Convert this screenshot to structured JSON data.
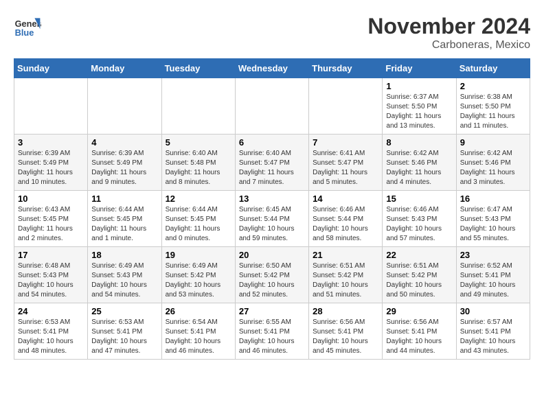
{
  "header": {
    "logo_general": "General",
    "logo_blue": "Blue",
    "title": "November 2024",
    "subtitle": "Carboneras, Mexico"
  },
  "days_of_week": [
    "Sunday",
    "Monday",
    "Tuesday",
    "Wednesday",
    "Thursday",
    "Friday",
    "Saturday"
  ],
  "weeks": [
    [
      {
        "day": "",
        "info": ""
      },
      {
        "day": "",
        "info": ""
      },
      {
        "day": "",
        "info": ""
      },
      {
        "day": "",
        "info": ""
      },
      {
        "day": "",
        "info": ""
      },
      {
        "day": "1",
        "info": "Sunrise: 6:37 AM\nSunset: 5:50 PM\nDaylight: 11 hours and 13 minutes."
      },
      {
        "day": "2",
        "info": "Sunrise: 6:38 AM\nSunset: 5:50 PM\nDaylight: 11 hours and 11 minutes."
      }
    ],
    [
      {
        "day": "3",
        "info": "Sunrise: 6:39 AM\nSunset: 5:49 PM\nDaylight: 11 hours and 10 minutes."
      },
      {
        "day": "4",
        "info": "Sunrise: 6:39 AM\nSunset: 5:49 PM\nDaylight: 11 hours and 9 minutes."
      },
      {
        "day": "5",
        "info": "Sunrise: 6:40 AM\nSunset: 5:48 PM\nDaylight: 11 hours and 8 minutes."
      },
      {
        "day": "6",
        "info": "Sunrise: 6:40 AM\nSunset: 5:47 PM\nDaylight: 11 hours and 7 minutes."
      },
      {
        "day": "7",
        "info": "Sunrise: 6:41 AM\nSunset: 5:47 PM\nDaylight: 11 hours and 5 minutes."
      },
      {
        "day": "8",
        "info": "Sunrise: 6:42 AM\nSunset: 5:46 PM\nDaylight: 11 hours and 4 minutes."
      },
      {
        "day": "9",
        "info": "Sunrise: 6:42 AM\nSunset: 5:46 PM\nDaylight: 11 hours and 3 minutes."
      }
    ],
    [
      {
        "day": "10",
        "info": "Sunrise: 6:43 AM\nSunset: 5:45 PM\nDaylight: 11 hours and 2 minutes."
      },
      {
        "day": "11",
        "info": "Sunrise: 6:44 AM\nSunset: 5:45 PM\nDaylight: 11 hours and 1 minute."
      },
      {
        "day": "12",
        "info": "Sunrise: 6:44 AM\nSunset: 5:45 PM\nDaylight: 11 hours and 0 minutes."
      },
      {
        "day": "13",
        "info": "Sunrise: 6:45 AM\nSunset: 5:44 PM\nDaylight: 10 hours and 59 minutes."
      },
      {
        "day": "14",
        "info": "Sunrise: 6:46 AM\nSunset: 5:44 PM\nDaylight: 10 hours and 58 minutes."
      },
      {
        "day": "15",
        "info": "Sunrise: 6:46 AM\nSunset: 5:43 PM\nDaylight: 10 hours and 57 minutes."
      },
      {
        "day": "16",
        "info": "Sunrise: 6:47 AM\nSunset: 5:43 PM\nDaylight: 10 hours and 55 minutes."
      }
    ],
    [
      {
        "day": "17",
        "info": "Sunrise: 6:48 AM\nSunset: 5:43 PM\nDaylight: 10 hours and 54 minutes."
      },
      {
        "day": "18",
        "info": "Sunrise: 6:49 AM\nSunset: 5:43 PM\nDaylight: 10 hours and 54 minutes."
      },
      {
        "day": "19",
        "info": "Sunrise: 6:49 AM\nSunset: 5:42 PM\nDaylight: 10 hours and 53 minutes."
      },
      {
        "day": "20",
        "info": "Sunrise: 6:50 AM\nSunset: 5:42 PM\nDaylight: 10 hours and 52 minutes."
      },
      {
        "day": "21",
        "info": "Sunrise: 6:51 AM\nSunset: 5:42 PM\nDaylight: 10 hours and 51 minutes."
      },
      {
        "day": "22",
        "info": "Sunrise: 6:51 AM\nSunset: 5:42 PM\nDaylight: 10 hours and 50 minutes."
      },
      {
        "day": "23",
        "info": "Sunrise: 6:52 AM\nSunset: 5:41 PM\nDaylight: 10 hours and 49 minutes."
      }
    ],
    [
      {
        "day": "24",
        "info": "Sunrise: 6:53 AM\nSunset: 5:41 PM\nDaylight: 10 hours and 48 minutes."
      },
      {
        "day": "25",
        "info": "Sunrise: 6:53 AM\nSunset: 5:41 PM\nDaylight: 10 hours and 47 minutes."
      },
      {
        "day": "26",
        "info": "Sunrise: 6:54 AM\nSunset: 5:41 PM\nDaylight: 10 hours and 46 minutes."
      },
      {
        "day": "27",
        "info": "Sunrise: 6:55 AM\nSunset: 5:41 PM\nDaylight: 10 hours and 46 minutes."
      },
      {
        "day": "28",
        "info": "Sunrise: 6:56 AM\nSunset: 5:41 PM\nDaylight: 10 hours and 45 minutes."
      },
      {
        "day": "29",
        "info": "Sunrise: 6:56 AM\nSunset: 5:41 PM\nDaylight: 10 hours and 44 minutes."
      },
      {
        "day": "30",
        "info": "Sunrise: 6:57 AM\nSunset: 5:41 PM\nDaylight: 10 hours and 43 minutes."
      }
    ]
  ]
}
